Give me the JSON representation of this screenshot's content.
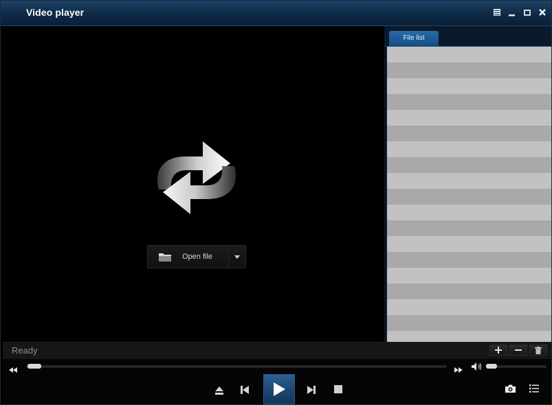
{
  "window": {
    "title": "Video player"
  },
  "player": {
    "open_file_label": "Open file"
  },
  "file_list": {
    "tab_label": "File list",
    "row_count": 19
  },
  "status": {
    "text": "Ready"
  },
  "seek": {
    "position": 0.02
  },
  "volume": {
    "level": 0.05
  },
  "icons": {
    "menu": "menu-icon",
    "minimize": "minimize-icon",
    "maximize": "maximize-icon",
    "close": "close-icon",
    "open_folder": "folder-icon",
    "dropdown": "chevron-down-icon",
    "add": "plus-icon",
    "remove": "minus-icon",
    "delete": "trash-icon",
    "eject": "eject-icon",
    "previous": "previous-icon",
    "play": "play-icon",
    "next": "next-icon",
    "stop": "stop-icon",
    "snapshot": "camera-icon",
    "playlist": "playlist-icon",
    "rewind": "rewind-icon",
    "fast_forward": "fast-forward-icon",
    "volume": "volume-icon"
  },
  "colors": {
    "titlebar": "#0e2a45",
    "accent": "#1a446f",
    "list_odd": "#c2c2c2",
    "list_even": "#a9a9a9"
  }
}
